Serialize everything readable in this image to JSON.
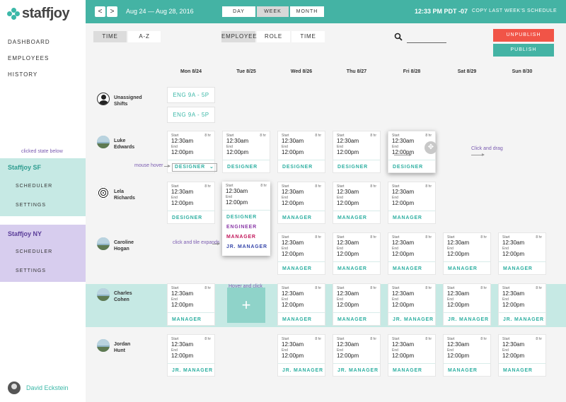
{
  "brand": {
    "name": "staffjoy"
  },
  "nav": [
    "DASHBOARD",
    "EMPLOYEES",
    "HISTORY"
  ],
  "annotations": {
    "clicked_state": "clicked state below",
    "mouse_hover": "mouse hover",
    "click_expand": "click and tile expands",
    "hover_click": "Hover and click",
    "click_drag": "Click and drag"
  },
  "orgs": [
    {
      "name": "Staffjoy SF",
      "links": [
        "SCHEDULER",
        "SETTINGS"
      ]
    },
    {
      "name": "Staffjoy NY",
      "links": [
        "SCHEDULER",
        "SETTINGS"
      ]
    }
  ],
  "user": {
    "name": "David Eckstein"
  },
  "header": {
    "prev": "<",
    "next": ">",
    "date_range": "Aug 24 — Aug 28, 2016",
    "views": [
      "DAY",
      "WEEK",
      "MONTH"
    ],
    "active_view": "WEEK",
    "clock": "12:33 PM PDT -07",
    "copy_link": "COPY LAST WEEK'S SCHEDULE"
  },
  "toolbar": {
    "sort": [
      "TIME",
      "A-Z"
    ],
    "group": [
      "EMPLOYEE",
      "ROLE",
      "TIME"
    ],
    "unpublish": "UNPUBLISH",
    "publish": "PUBLISH"
  },
  "days": [
    "Mon 8/24",
    "Tue 8/25",
    "Wed 8/26",
    "Thu 8/27",
    "Fri 8/28",
    "Sat 8/29",
    "Sun 8/30"
  ],
  "shift_labels": {
    "start": "Start",
    "end": "End",
    "hours": "8 hr",
    "start_time": "12:30am",
    "end_time": "12:00pm"
  },
  "open_shifts": [
    "ENG 9A - 5P",
    "ENG 9A - 5P"
  ],
  "employees": [
    {
      "first": "Unassigned",
      "last": "Shifts"
    },
    {
      "first": "Luke",
      "last": "Edwards"
    },
    {
      "first": "Lela",
      "last": "Richards"
    },
    {
      "first": "Caroline",
      "last": "Hogan"
    },
    {
      "first": "Charles",
      "last": "Cohen"
    },
    {
      "first": "Jordan",
      "last": "Hunt"
    }
  ],
  "roles": {
    "designer": "DESIGNER",
    "manager": "MANAGER",
    "jr_manager": "JR. MANAGER",
    "engineer": "ENGINEER"
  },
  "role_colors": {
    "designer": "#2fb0a2",
    "engineer": "#8b3aa8",
    "manager": "#c2185b",
    "jr_manager": "#3949ab"
  },
  "expanded_roles": [
    "DESIGNER",
    "ENGINEER",
    "MANAGER",
    "JR. MANAGER"
  ],
  "hover_plus": "+",
  "drag_glyph": "✥",
  "dropdown_caret": "⌄"
}
